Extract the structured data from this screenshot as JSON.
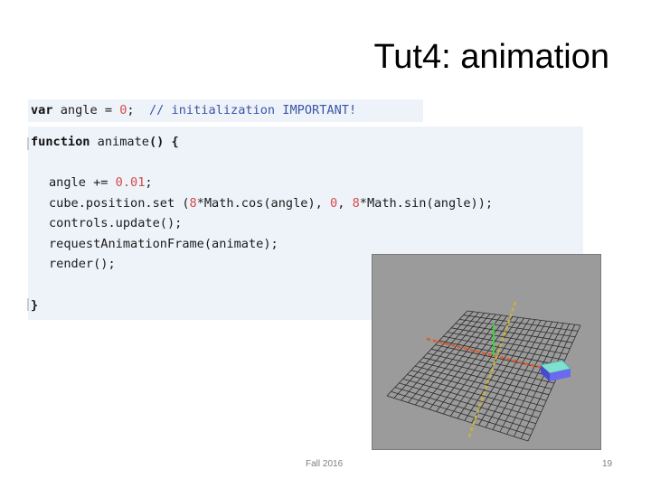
{
  "slide": {
    "title": "Tut4: animation",
    "footer": "Fall 2016",
    "page_number": "19"
  },
  "code": {
    "line1": {
      "kw": "var",
      "rest": " angle = ",
      "num": "0",
      "semi": ";  ",
      "comment": "// initialization IMPORTANT!"
    },
    "fn_kw": "function",
    "fn_name": " animate",
    "fn_paren": "() {",
    "l_angle": "angle += ",
    "l_angle_num": "0.01",
    "l_angle_end": ";",
    "l_cube_a": "cube.position.set (",
    "l_cube_n1": "8",
    "l_cube_b": "*Math.cos(angle), ",
    "l_cube_n2": "0",
    "l_cube_c": ", ",
    "l_cube_n3": "8",
    "l_cube_d": "*Math.sin(angle));",
    "l_controls": "controls.update();",
    "l_raf": "requestAnimationFrame(animate);",
    "l_render": "render();",
    "close": "}"
  },
  "colors": {
    "code_bg": "#eef3fa",
    "number": "#d44b4b",
    "comment": "#3b55a8",
    "viewport_bg": "#9b9b9b",
    "grid": "#2b2b2b",
    "axis_x": "#e05a2a",
    "axis_y": "#3ad13a",
    "axis_z": "#c9b23a",
    "cube_top": "#7fe0d0",
    "cube_side": "#5a5ae0"
  }
}
